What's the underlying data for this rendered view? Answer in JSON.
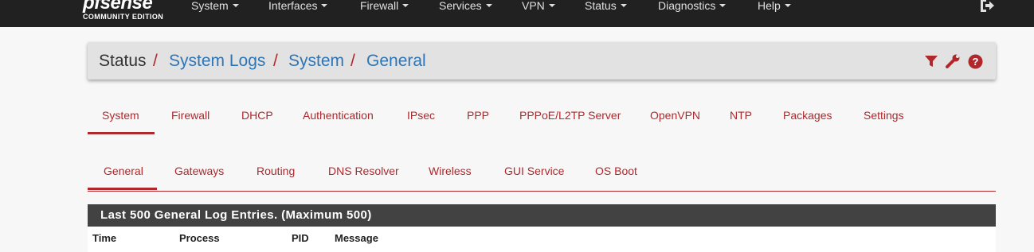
{
  "brand": {
    "name": "pfsense",
    "edition": "COMMUNITY EDITION"
  },
  "nav": {
    "items": [
      {
        "label": "System"
      },
      {
        "label": "Interfaces"
      },
      {
        "label": "Firewall"
      },
      {
        "label": "Services"
      },
      {
        "label": "VPN"
      },
      {
        "label": "Status"
      },
      {
        "label": "Diagnostics"
      },
      {
        "label": "Help"
      }
    ],
    "logout_icon": "sign-out-icon"
  },
  "breadcrumb": {
    "items": [
      {
        "label": "Status"
      },
      {
        "label": "System Logs"
      },
      {
        "label": "System"
      },
      {
        "label": "General"
      }
    ],
    "separator": "/",
    "icons": [
      "filter-icon",
      "wrench-icon",
      "help-icon"
    ]
  },
  "log_tabs": {
    "items": [
      {
        "label": "System"
      },
      {
        "label": "Firewall"
      },
      {
        "label": "DHCP"
      },
      {
        "label": "Authentication"
      },
      {
        "label": "IPsec"
      },
      {
        "label": "PPP"
      },
      {
        "label": "PPPoE/L2TP Server"
      },
      {
        "label": "OpenVPN"
      },
      {
        "label": "NTP"
      },
      {
        "label": "Packages"
      },
      {
        "label": "Settings"
      }
    ],
    "active": "System"
  },
  "system_tabs": {
    "items": [
      {
        "label": "General"
      },
      {
        "label": "Gateways"
      },
      {
        "label": "Routing"
      },
      {
        "label": "DNS Resolver"
      },
      {
        "label": "Wireless"
      },
      {
        "label": "GUI Service"
      },
      {
        "label": "OS Boot"
      }
    ],
    "active": "General"
  },
  "log_panel": {
    "title": "Last 500 General Log Entries. (Maximum 500)",
    "columns": [
      "Time",
      "Process",
      "PID",
      "Message"
    ]
  },
  "colors": {
    "accent": "#b0282c",
    "link": "#2e75b6",
    "topbar": "#212121",
    "panel_header": "#424242"
  }
}
